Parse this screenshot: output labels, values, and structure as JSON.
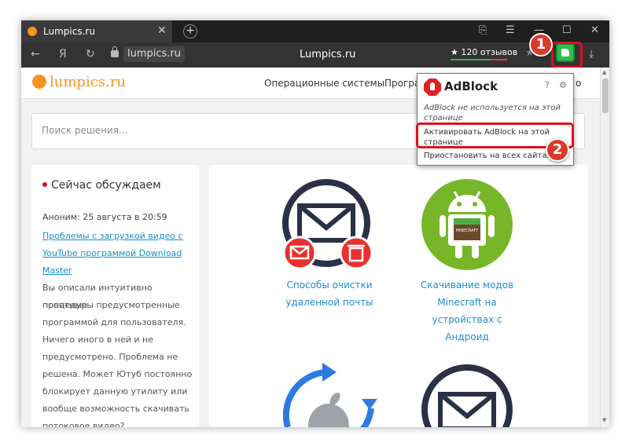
{
  "browser": {
    "tab": {
      "title": "Lumpics.ru",
      "close": "✕"
    },
    "new_tab": "+",
    "window_controls": {
      "sync": "⎘",
      "menu": "☰",
      "minimize": "—",
      "maximize": "☐",
      "close": "✕"
    },
    "nav": {
      "back": "←",
      "yandex": "Я",
      "reload": "↻"
    },
    "domain": "lumpics.ru",
    "page_title": "Lumpics.ru",
    "reviews": "★ 120 отзывов",
    "download": "⤓",
    "scroll_up": "▲",
    "scroll_down": "▼"
  },
  "site": {
    "logo": "lumpics.ru",
    "menu": [
      "Операционные системы",
      "Програ",
      "о"
    ],
    "search_placeholder": "Поиск решения...",
    "sidebar": {
      "heading": "Сейчас обсуждаем",
      "meta": "Аноним: 25 августа в 20:59",
      "link_lines": [
        "Проблемы с загрузкой видео с",
        "YouTube программой Download",
        "Master"
      ],
      "text_lines": [
        "Вы описали интуитивно понятные",
        "процедуры предусмотренные",
        "программой для пользователя.",
        "Ничего иного в ней и не",
        "предусмотрено. Проблема не",
        "решена. Может Ютуб постоянно",
        "блокирует данную утилиту или",
        "вообще возможность скачивать",
        "потоковое видео?"
      ]
    },
    "articles": [
      {
        "lines": [
          "Способы очистки",
          "удаленной почты"
        ]
      },
      {
        "lines": [
          "Скачивание модов",
          "Minecraft на",
          "устройствах с",
          "Андроид"
        ]
      }
    ],
    "android_badge": "MINECRAFT"
  },
  "adblock_popup": {
    "brand": "AdBlock",
    "help_icon": "?",
    "settings_icon": "⚙",
    "status_lines": [
      "AdBlock не используется на этой",
      "странице"
    ],
    "activate_lines": [
      "Активировать AdBlock на этой",
      "странице"
    ],
    "pause": "Приостановить на всех сайтах"
  },
  "annotations": {
    "step1": "1",
    "step2": "2"
  },
  "colors": {
    "accent": "#f7941d",
    "link": "#1a8fc9",
    "highlight": "#e0101e",
    "android": "#78b629",
    "envelope": "#2b3046"
  }
}
